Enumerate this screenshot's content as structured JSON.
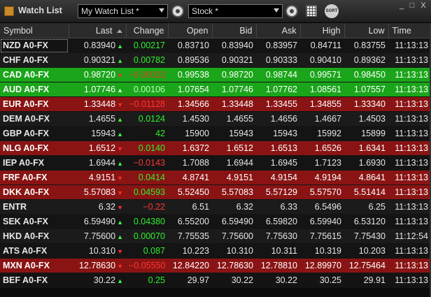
{
  "window": {
    "title": "Watch List",
    "watchlist_combo": "My Watch List *",
    "type_combo": "Stock *",
    "sort_label": "SORT",
    "minimize": "_",
    "maximize": "□",
    "close": "X"
  },
  "columns": [
    "Symbol",
    "Last",
    "Change",
    "Open",
    "Bid",
    "Ask",
    "High",
    "Low",
    "Time"
  ],
  "rows": [
    {
      "symbol": "NZD A0-FX",
      "last": "0.83940",
      "dir": "up",
      "change": "0.00217",
      "open": "0.83710",
      "bid": "0.83940",
      "ask": "0.83957",
      "high": "0.84711",
      "low": "0.83755",
      "time": "11:13:13",
      "style": "neutral"
    },
    {
      "symbol": "CHF A0-FX",
      "last": "0.90321",
      "dir": "up",
      "change": "0.00782",
      "open": "0.89536",
      "bid": "0.90321",
      "ask": "0.90333",
      "high": "0.90410",
      "low": "0.89362",
      "time": "11:13:13",
      "style": "neutral"
    },
    {
      "symbol": "CAD A0-FX",
      "last": "0.98720",
      "dir": "down",
      "change": "−0.00012",
      "open": "0.99538",
      "bid": "0.98720",
      "ask": "0.98744",
      "high": "0.99571",
      "low": "0.98450",
      "time": "11:13:13",
      "style": "green"
    },
    {
      "symbol": "AUD A0-FX",
      "last": "1.07746",
      "dir": "up",
      "change": "0.00106",
      "open": "1.07654",
      "bid": "1.07746",
      "ask": "1.07762",
      "high": "1.08561",
      "low": "1.07557",
      "time": "11:13:13",
      "style": "green"
    },
    {
      "symbol": "EUR A0-FX",
      "last": "1.33448",
      "dir": "down",
      "change": "−0.01128",
      "open": "1.34566",
      "bid": "1.33448",
      "ask": "1.33455",
      "high": "1.34855",
      "low": "1.33340",
      "time": "11:13:13",
      "style": "red"
    },
    {
      "symbol": "DEM A0-FX",
      "last": "1.4655",
      "dir": "up",
      "change": "0.0124",
      "open": "1.4530",
      "bid": "1.4655",
      "ask": "1.4656",
      "high": "1.4667",
      "low": "1.4503",
      "time": "11:13:13",
      "style": "neutral"
    },
    {
      "symbol": "GBP A0-FX",
      "last": "15943",
      "dir": "up",
      "change": "42",
      "open": "15900",
      "bid": "15943",
      "ask": "15943",
      "high": "15992",
      "low": "15899",
      "time": "11:13:13",
      "style": "neutral"
    },
    {
      "symbol": "NLG A0-FX",
      "last": "1.6512",
      "dir": "down",
      "change": "0.0140",
      "open": "1.6372",
      "bid": "1.6512",
      "ask": "1.6513",
      "high": "1.6526",
      "low": "1.6341",
      "time": "11:13:13",
      "style": "red"
    },
    {
      "symbol": "IEP A0-FX",
      "last": "1.6944",
      "dir": "up",
      "change": "−0.0143",
      "open": "1.7088",
      "bid": "1.6944",
      "ask": "1.6945",
      "high": "1.7123",
      "low": "1.6930",
      "time": "11:13:13",
      "style": "neutral"
    },
    {
      "symbol": "FRF A0-FX",
      "last": "4.9151",
      "dir": "down",
      "change": "0.0414",
      "open": "4.8741",
      "bid": "4.9151",
      "ask": "4.9154",
      "high": "4.9194",
      "low": "4.8641",
      "time": "11:13:13",
      "style": "red"
    },
    {
      "symbol": "DKK A0-FX",
      "last": "5.57083",
      "dir": "down",
      "change": "0.04593",
      "open": "5.52450",
      "bid": "5.57083",
      "ask": "5.57129",
      "high": "5.57570",
      "low": "5.51414",
      "time": "11:13:13",
      "style": "red"
    },
    {
      "symbol": "ENTR",
      "last": "6.32",
      "dir": "down",
      "change": "−0.22",
      "open": "6.51",
      "bid": "6.32",
      "ask": "6.33",
      "high": "6.5496",
      "low": "6.25",
      "time": "11:13:13",
      "style": "neutral"
    },
    {
      "symbol": "SEK A0-FX",
      "last": "6.59490",
      "dir": "up",
      "change": "0.04380",
      "open": "6.55200",
      "bid": "6.59490",
      "ask": "6.59820",
      "high": "6.59940",
      "low": "6.53120",
      "time": "11:13:13",
      "style": "neutral"
    },
    {
      "symbol": "HKD A0-FX",
      "last": "7.75600",
      "dir": "up",
      "change": "0.00070",
      "open": "7.75535",
      "bid": "7.75600",
      "ask": "7.75630",
      "high": "7.75615",
      "low": "7.75430",
      "time": "11:12:54",
      "style": "neutral"
    },
    {
      "symbol": "ATS A0-FX",
      "last": "10.310",
      "dir": "down",
      "change": "0.087",
      "open": "10.223",
      "bid": "10.310",
      "ask": "10.311",
      "high": "10.319",
      "low": "10.203",
      "time": "11:13:13",
      "style": "neutral"
    },
    {
      "symbol": "MXN A0-FX",
      "last": "12.78630",
      "dir": "down",
      "change": "−0.05550",
      "open": "12.84220",
      "bid": "12.78630",
      "ask": "12.78810",
      "high": "12.89970",
      "low": "12.75464",
      "time": "11:13:13",
      "style": "red"
    },
    {
      "symbol": "BEF A0-FX",
      "last": "30.22",
      "dir": "up",
      "change": "0.25",
      "open": "29.97",
      "bid": "30.22",
      "ask": "30.22",
      "high": "30.25",
      "low": "29.91",
      "time": "11:13:13",
      "style": "neutral"
    }
  ]
}
